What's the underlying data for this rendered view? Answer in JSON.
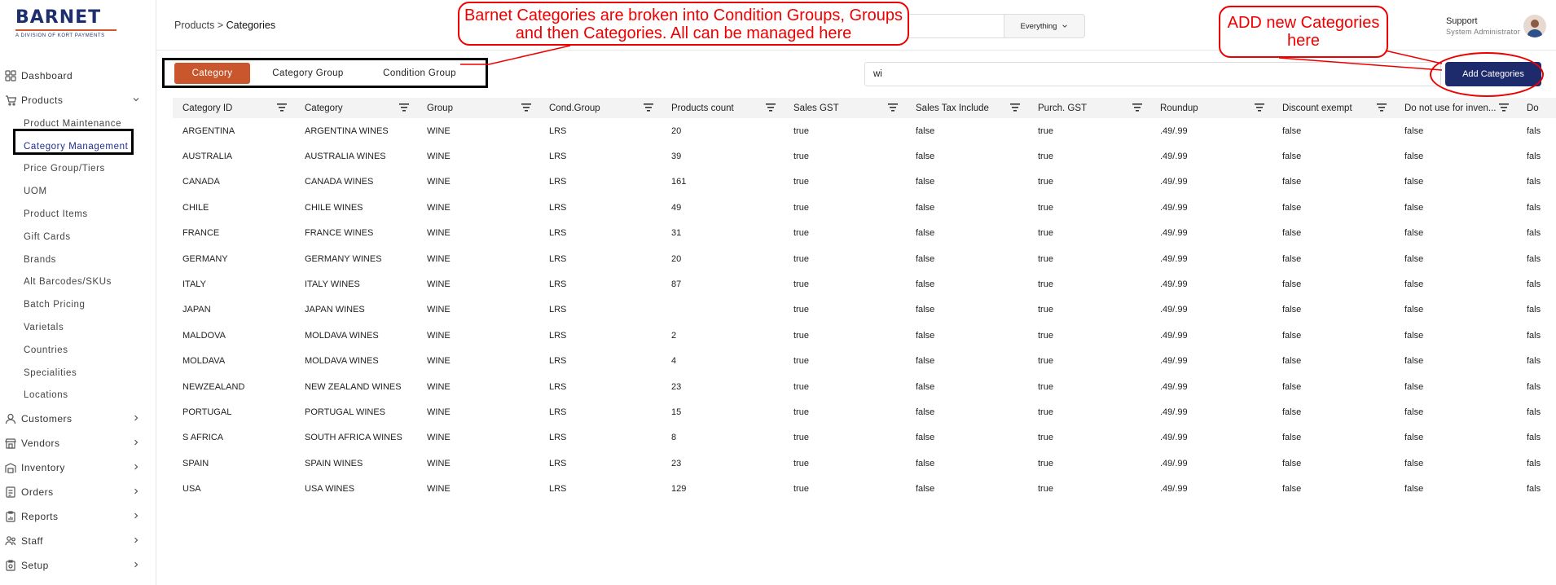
{
  "logo": {
    "main": "BARNET",
    "sub": "A DIVISION OF KORT PAYMENTS"
  },
  "nav": {
    "items": [
      {
        "label": "Dashboard",
        "icon": "grid-icon"
      },
      {
        "label": "Products",
        "icon": "cart-icon"
      },
      {
        "label": "Customers",
        "icon": "user-icon"
      },
      {
        "label": "Vendors",
        "icon": "store-icon"
      },
      {
        "label": "Inventory",
        "icon": "warehouse-icon"
      },
      {
        "label": "Orders",
        "icon": "orders-icon"
      },
      {
        "label": "Reports",
        "icon": "clipboard-icon"
      },
      {
        "label": "Staff",
        "icon": "staff-icon"
      },
      {
        "label": "Setup",
        "icon": "setup-icon"
      }
    ],
    "products_sub": [
      "Product Maintenance",
      "Category Management",
      "Price Group/Tiers",
      "UOM",
      "Product Items",
      "Gift Cards",
      "Brands",
      "Alt Barcodes/SKUs",
      "Batch Pricing",
      "Varietals",
      "Countries",
      "Specialities",
      "Locations"
    ],
    "active_sub": "Category Management"
  },
  "header": {
    "breadcrumb_parent": "Products",
    "breadcrumb_sep": ">",
    "breadcrumb_current": "Categories",
    "scope": "Everything",
    "user_name": "Support",
    "user_role": "System Administrator"
  },
  "tabs": [
    "Category",
    "Category Group",
    "Condition Group"
  ],
  "filter": {
    "value": "wi"
  },
  "add_button": "Add Categories",
  "table": {
    "columns": [
      "Category ID",
      "Category",
      "Group",
      "Cond.Group",
      "Products count",
      "Sales GST",
      "Sales Tax Include",
      "Purch. GST",
      "Roundup",
      "Discount exempt",
      "Do not use for inven...",
      "Do"
    ],
    "rows": [
      [
        "ARGENTINA",
        "ARGENTINA WINES",
        "WINE",
        "LRS",
        "20",
        "true",
        "false",
        "true",
        ".49/.99",
        "false",
        "false",
        "fals"
      ],
      [
        "AUSTRALIA",
        "AUSTRALIA WINES",
        "WINE",
        "LRS",
        "39",
        "true",
        "false",
        "true",
        ".49/.99",
        "false",
        "false",
        "fals"
      ],
      [
        "CANADA",
        "CANADA WINES",
        "WINE",
        "LRS",
        "161",
        "true",
        "false",
        "true",
        ".49/.99",
        "false",
        "false",
        "fals"
      ],
      [
        "CHILE",
        "CHILE WINES",
        "WINE",
        "LRS",
        "49",
        "true",
        "false",
        "true",
        ".49/.99",
        "false",
        "false",
        "fals"
      ],
      [
        "FRANCE",
        "FRANCE WINES",
        "WINE",
        "LRS",
        "31",
        "true",
        "false",
        "true",
        ".49/.99",
        "false",
        "false",
        "fals"
      ],
      [
        "GERMANY",
        "GERMANY WINES",
        "WINE",
        "LRS",
        "20",
        "true",
        "false",
        "true",
        ".49/.99",
        "false",
        "false",
        "fals"
      ],
      [
        "ITALY",
        "ITALY WINES",
        "WINE",
        "LRS",
        "87",
        "true",
        "false",
        "true",
        ".49/.99",
        "false",
        "false",
        "fals"
      ],
      [
        "JAPAN",
        "JAPAN WINES",
        "WINE",
        "LRS",
        "",
        "true",
        "false",
        "true",
        ".49/.99",
        "false",
        "false",
        "fals"
      ],
      [
        "MALDOVA",
        "MOLDAVA WINES",
        "WINE",
        "LRS",
        "2",
        "true",
        "false",
        "true",
        ".49/.99",
        "false",
        "false",
        "fals"
      ],
      [
        "MOLDAVA",
        "MOLDAVA WINES",
        "WINE",
        "LRS",
        "4",
        "true",
        "false",
        "true",
        ".49/.99",
        "false",
        "false",
        "fals"
      ],
      [
        "NEWZEALAND",
        "NEW ZEALAND WINES",
        "WINE",
        "LRS",
        "23",
        "true",
        "false",
        "true",
        ".49/.99",
        "false",
        "false",
        "fals"
      ],
      [
        "PORTUGAL",
        "PORTUGAL WINES",
        "WINE",
        "LRS",
        "15",
        "true",
        "false",
        "true",
        ".49/.99",
        "false",
        "false",
        "fals"
      ],
      [
        "S AFRICA",
        "SOUTH AFRICA WINES",
        "WINE",
        "LRS",
        "8",
        "true",
        "false",
        "true",
        ".49/.99",
        "false",
        "false",
        "fals"
      ],
      [
        "SPAIN",
        "SPAIN WINES",
        "WINE",
        "LRS",
        "23",
        "true",
        "false",
        "true",
        ".49/.99",
        "false",
        "false",
        "fals"
      ],
      [
        "USA",
        "USA WINES",
        "WINE",
        "LRS",
        "129",
        "true",
        "false",
        "true",
        ".49/.99",
        "false",
        "false",
        "fals"
      ]
    ]
  },
  "annotations": {
    "callout1": "Barnet Categories are broken into Condition Groups, Groups and then Categories. All can be managed here",
    "callout2": "ADD new Categories here"
  },
  "colors": {
    "accent": "#c9562d",
    "primary": "#1d2a6c",
    "annotation": "#e00000"
  }
}
